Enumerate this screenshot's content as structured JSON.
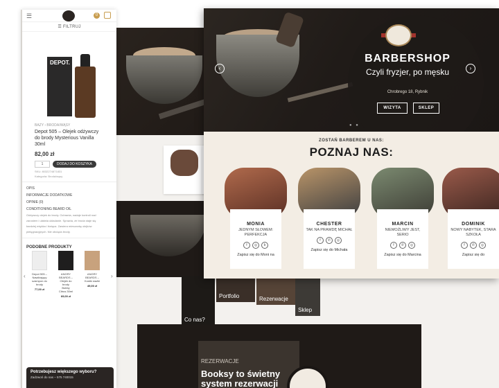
{
  "mobile": {
    "menu_icon": "hamburger-icon",
    "cart_count": "0",
    "filter_label": "☰ FILTRUJ",
    "product_brand": "DEPOT.",
    "breadcrumb": "BAZY › BRODA/WĄSY",
    "product_title": "Depot 505 – Olejek odżywczy do brody Mysterious Vanilla 30ml",
    "price": "82,00 zł",
    "qty": "1",
    "add_to_cart": "DODAJ DO KOSZYKA",
    "sku": "SKU: 8032274871831",
    "category": "Kategoria: Broda/wąsy",
    "tab_opis": "OPIS",
    "tab_info": "INFORMACJE DODATKOWE",
    "tab_opinie": "OPINIE (0)",
    "section_heading": "CONDITIONING BEARD OIL",
    "desc_lines": [
      "Odżywczy olejek do brody. Ochrania, nadaje kontroli nad",
      "zarostem i ułatwia układanie. Sprawia, że broda staje się",
      "bardziej miękka i lśniąca. Zawiera mieszankę olejków",
      "pielęgnacyjnych. Nie obciąża brody."
    ],
    "related_heading": "PODOBNE PRODUKTY",
    "related": [
      {
        "name": "Depot 505 – Nawilżający szampon do brody",
        "price": "77,00 zł"
      },
      {
        "name": "ANGRY BEARDS – Olejek do brody Bobby Citrus 30ml",
        "price": "69,00 zł"
      },
      {
        "name": "ANGRY BEARDS – Kostki ważki",
        "price": "49,00 zł"
      }
    ],
    "cta_title": "Potrzebujesz większego wyboru?",
    "cta_text": "Zadzwoń do nas – 575 740015"
  },
  "hero": {
    "title": "BARBERSHOP",
    "subtitle": "Czyli fryzjer, po męsku",
    "address": "Chrobrego 18, Rybnik",
    "btn_visit": "WIZYTA",
    "btn_shop": "SKLEP",
    "prev_icon": "chevron-left-icon",
    "next_icon": "chevron-right-icon"
  },
  "team_section": {
    "kicker": "ZOSTAŃ BARBEREM U NAS:",
    "title": "POZNAJ NAS:",
    "members": [
      {
        "name": "MONIA",
        "desc": "JEDNYM SŁOWEM: PERFEKCJA",
        "link": "Zapisz się do Moni na"
      },
      {
        "name": "CHESTER",
        "desc": "TAK NA PRAWDĘ MICHAŁ",
        "link": "Zapisz się do Michała"
      },
      {
        "name": "MARCIN",
        "desc": "NIEMOŻLIWY JEST, SERIO",
        "link": "Zapisz się do Marcina"
      },
      {
        "name": "DOMINIK",
        "desc": "NOWY NABYTEK, STARA SZKOŁA",
        "link": "Zapisz się do"
      }
    ]
  },
  "background_page": {
    "tile1": "Co nas?",
    "tile2": "Rezerwacje",
    "tile3": "Sklep",
    "tile4": "Portfolio",
    "booksy_kicker": "REZERWACJE",
    "booksy_title": "Booksy to świetny system rezerwacji"
  }
}
